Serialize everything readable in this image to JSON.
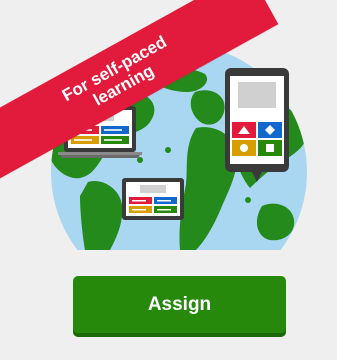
{
  "ribbon": {
    "line1": "For self-paced",
    "line2": "learning",
    "color": "#e21b3c"
  },
  "button": {
    "label": "Assign",
    "color": "#26890c"
  },
  "illustration": {
    "globe_ocean_color": "#a9d7f2",
    "globe_land_color": "#248a1c",
    "device_frame_color": "#3a3a3a",
    "answer_colors": [
      "#e21b3c",
      "#1368ce",
      "#d89e00",
      "#26890c"
    ],
    "answer_shapes": [
      "triangle-icon",
      "diamond-icon",
      "circle-icon",
      "square-icon"
    ]
  }
}
